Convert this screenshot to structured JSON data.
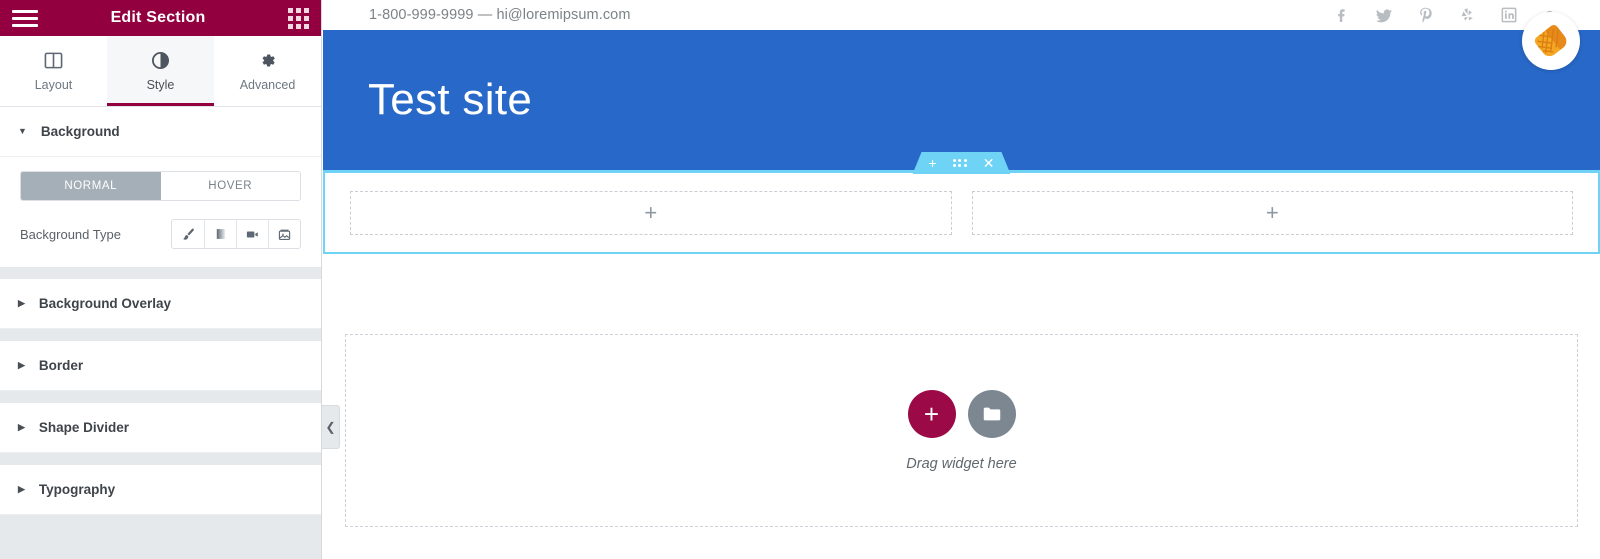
{
  "panel": {
    "header": {
      "title": "Edit Section",
      "menu_icon": "hamburger-icon",
      "apps_icon": "grid-apps-icon"
    },
    "tabs": [
      {
        "id": "layout",
        "label": "Layout",
        "icon": "columns-icon",
        "active": false
      },
      {
        "id": "style",
        "label": "Style",
        "icon": "contrast-icon",
        "active": true
      },
      {
        "id": "advanced",
        "label": "Advanced",
        "icon": "gear-icon",
        "active": false
      }
    ],
    "sections": [
      {
        "id": "background",
        "label": "Background",
        "open": true
      },
      {
        "id": "background-overlay",
        "label": "Background Overlay",
        "open": false
      },
      {
        "id": "border",
        "label": "Border",
        "open": false
      },
      {
        "id": "shape-divider",
        "label": "Shape Divider",
        "open": false
      },
      {
        "id": "typography",
        "label": "Typography",
        "open": false
      }
    ],
    "background": {
      "state_toggle": {
        "options": [
          "NORMAL",
          "HOVER"
        ],
        "selected": "NORMAL"
      },
      "background_type": {
        "label": "Background Type",
        "options": [
          {
            "id": "classic",
            "icon": "paintbrush-icon"
          },
          {
            "id": "gradient",
            "icon": "gradient-icon"
          },
          {
            "id": "video",
            "icon": "video-camera-icon"
          },
          {
            "id": "slideshow",
            "icon": "slideshow-image-icon"
          }
        ]
      }
    },
    "collapse_button": {
      "icon": "chevron-left-icon"
    },
    "colors": {
      "brand": "#93003f",
      "panel_bg": "#e6e9ec",
      "toggle_active": "#a4afb7"
    }
  },
  "preview": {
    "topbar": {
      "contact": "1-800-999-9999 — hi@loremipsum.com",
      "socials": [
        {
          "id": "facebook",
          "icon": "facebook-icon",
          "glyph": "f"
        },
        {
          "id": "twitter",
          "icon": "twitter-icon",
          "glyph": "t"
        },
        {
          "id": "pinterest",
          "icon": "pinterest-icon",
          "glyph": "P"
        },
        {
          "id": "yelp",
          "icon": "yelp-icon",
          "glyph": "y"
        },
        {
          "id": "linkedin",
          "icon": "linkedin-icon",
          "glyph": "in"
        },
        {
          "id": "google",
          "icon": "google-plus-icon",
          "glyph": "g"
        }
      ],
      "badge": {
        "icon": "waffle-cone-badge-icon",
        "colors": {
          "fill": "#f5a623",
          "shade": "#e8891c"
        }
      }
    },
    "hero": {
      "title": "Test site",
      "bg_color": "#2868c8"
    },
    "selected_section": {
      "toolbar": [
        {
          "id": "add",
          "icon": "plus-icon",
          "glyph": "+"
        },
        {
          "id": "drag",
          "icon": "drag-dots-icon"
        },
        {
          "id": "remove",
          "icon": "close-x-icon",
          "glyph": "✕"
        }
      ],
      "accent_color": "#6ed3f5",
      "columns": [
        {
          "id": "col-1",
          "icon": "plus-icon",
          "glyph": "+"
        },
        {
          "id": "col-2",
          "icon": "plus-icon",
          "glyph": "+"
        }
      ]
    },
    "widget_drop": {
      "text": "Drag widget here",
      "add_button": {
        "icon": "plus-icon",
        "glyph": "+",
        "color": "#9b0a46"
      },
      "folder_button": {
        "icon": "folder-icon",
        "color": "#7c8791"
      }
    }
  }
}
